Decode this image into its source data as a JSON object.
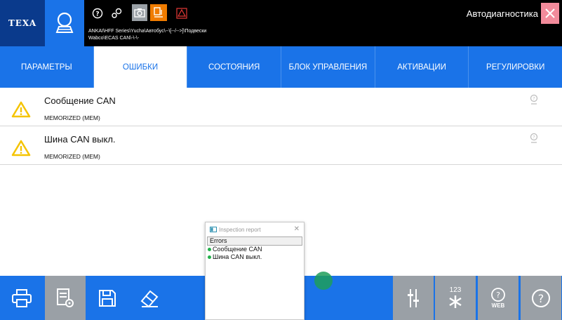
{
  "header": {
    "logo": "TEXA",
    "path_line1": "ANKAI\\HFF Series\\Yucha\\Автобус\\--\\[--/-->]\\Подвески",
    "path_line2": "Wabco\\ECAS CAN\\-\\-\\-",
    "title": "Автодиагностика"
  },
  "tabs": [
    {
      "label": "ПАРАМЕТРЫ"
    },
    {
      "label": "ОШИБКИ"
    },
    {
      "label": "СОСТОЯНИЯ"
    },
    {
      "label": "БЛОК УПРАВЛЕНИЯ"
    },
    {
      "label": "АКТИВАЦИИ"
    },
    {
      "label": "РЕГУЛИРОВКИ"
    }
  ],
  "active_tab": 1,
  "errors": [
    {
      "name": "Сообщение CAN",
      "status": "MEMORIZED (MEM)"
    },
    {
      "name": "Шина CAN выкл.",
      "status": "MEMORIZED (MEM)"
    }
  ],
  "popup": {
    "title": "Inspection report",
    "header": "Errors",
    "items": [
      "Сообщение CAN",
      "Шина CAN выкл."
    ]
  },
  "bottom": {
    "num_label": "123",
    "web_label": "WEB"
  },
  "colors": {
    "primary_blue": "#1a73e8",
    "header_bg": "#000000",
    "warning_yellow": "#f5c400",
    "close_pink": "#f28b9b",
    "orange": "#f07c00"
  }
}
